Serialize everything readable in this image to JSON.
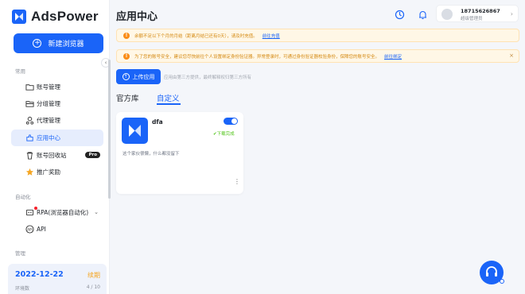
{
  "brand": {
    "name": "AdsPower",
    "accent": "#1a64f8"
  },
  "sidebar": {
    "new_browser": "新建浏览器",
    "collapse_icon": "‹",
    "sections": {
      "common": "常用",
      "automation": "自动化",
      "manage": "管理"
    },
    "items": [
      {
        "label": "账号管理",
        "icon": "folder-icon"
      },
      {
        "label": "分组管理",
        "icon": "folder-open-icon"
      },
      {
        "label": "代理管理",
        "icon": "proxy-icon"
      },
      {
        "label": "应用中心",
        "icon": "app-center-icon",
        "active": true
      },
      {
        "label": "账号回收站",
        "icon": "trash-icon",
        "badge": "Pro"
      },
      {
        "label": "推广奖励",
        "icon": "star-icon"
      },
      {
        "label": "RPA(浏览器自动化)",
        "icon": "rpa-icon"
      },
      {
        "label": "API",
        "icon": "api-icon"
      }
    ],
    "plan": {
      "expiry": "2022-12-22",
      "renew": "续期",
      "env_label": "环境数",
      "env_count": "4 / 10"
    }
  },
  "header": {
    "title": "应用中心",
    "user": {
      "phone": "18715626867",
      "role": "超级管理员"
    }
  },
  "alerts": [
    {
      "text": "余额不足以下个月的月结（距离月结已还有0天），请及时充值。",
      "link": "前往充值"
    },
    {
      "text": "为了您的账号安全，建议您尽快前往个人设置绑定身份验证器。异常登录时，可通过身份验证器校验身份，保障您的账号安全。",
      "link": "前往绑定"
    }
  ],
  "upload": {
    "label": "上传应用",
    "hint": "应用由第三方提供，最终解释权归第三方所有"
  },
  "tabs": [
    {
      "label": "官方库"
    },
    {
      "label": "自定义",
      "active": true
    }
  ],
  "apps": [
    {
      "name": "dfa",
      "status": "下载完成",
      "enabled": true,
      "description": "这个家伙很懒，什么都没留下"
    }
  ]
}
